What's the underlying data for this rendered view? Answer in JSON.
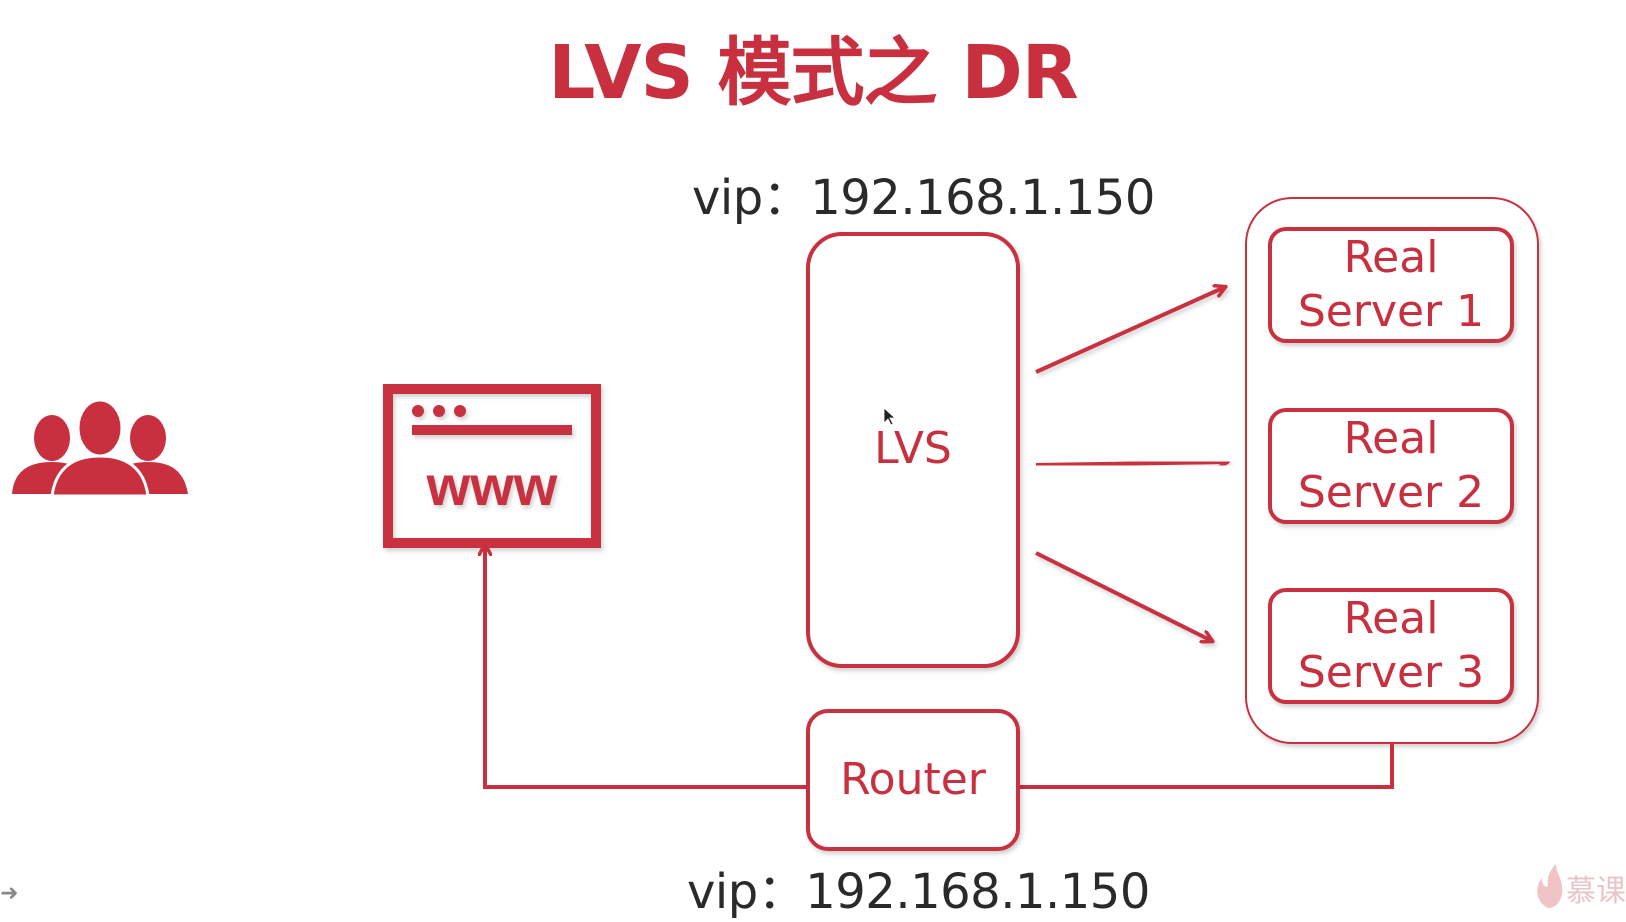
{
  "title": "LVS 模式之 DR",
  "vip_top": "vip：192.168.1.150",
  "vip_bottom": "vip：192.168.1.150",
  "www_label": "www",
  "lvs_label": "LVS",
  "router_label": "Router",
  "real_servers": [
    {
      "line1": "Real",
      "line2": "Server 1"
    },
    {
      "line1": "Real",
      "line2": "Server 2"
    },
    {
      "line1": "Real",
      "line2": "Server 3"
    }
  ],
  "watermark": "慕课",
  "colors": {
    "accent": "#c8303f",
    "text": "#2a2a2a"
  },
  "icons": [
    "users-icon",
    "browser-www-icon",
    "flame-logo-icon",
    "next-slide-icon"
  ]
}
